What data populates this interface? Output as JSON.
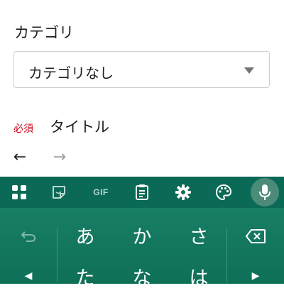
{
  "form": {
    "category_label": "カテゴリ",
    "category_selected": "カテゴリなし",
    "required_badge": "必須",
    "title_label": "タイトル"
  },
  "nav": {
    "back_arrow": "←",
    "forward_arrow": "→"
  },
  "keyboard": {
    "toolbar": {
      "gif_label": "GIF",
      "icons": [
        "apps-grid-icon",
        "sticker-icon",
        "gif-icon",
        "clipboard-icon",
        "settings-gear-icon",
        "theme-palette-icon",
        "microphone-icon"
      ]
    },
    "row1": [
      "あ",
      "か",
      "さ"
    ],
    "row2": [
      "た",
      "な",
      "は"
    ],
    "left_key_icon": "undo-icon",
    "right_key_icon": "backspace-icon",
    "left_arrow_key": "◀",
    "right_arrow_key": "▶"
  },
  "colors": {
    "keyboard_toolbar": "#0b6a55",
    "keyboard_body": "#177e64",
    "required_red": "#d0021b"
  }
}
